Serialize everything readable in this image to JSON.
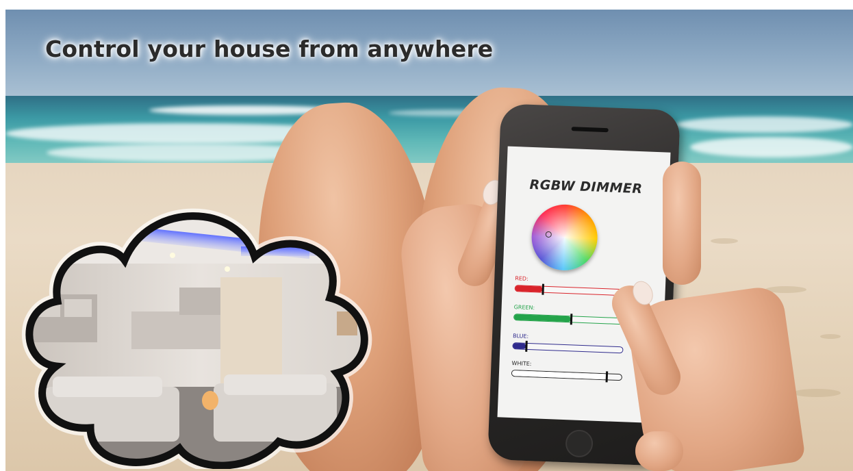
{
  "headline": "Control your house from anywhere",
  "phone": {
    "title": "RGBW DIMMER",
    "sliders": [
      {
        "label": "RED:",
        "color": "#d9232a",
        "value": 0.25
      },
      {
        "label": "GREEN:",
        "color": "#23a34a",
        "value": 0.52
      },
      {
        "label": "BLUE:",
        "color": "#2e2a8c",
        "value": 0.12
      },
      {
        "label": "WHITE:",
        "color": "#222222",
        "value": 0.86
      }
    ]
  },
  "colors": {
    "headline_text": "#2b2b2b",
    "sea": "#3c9aa5",
    "sand": "#e6d6c0",
    "cloud_outline": "#111111",
    "led_strip": "#5b6cff"
  }
}
